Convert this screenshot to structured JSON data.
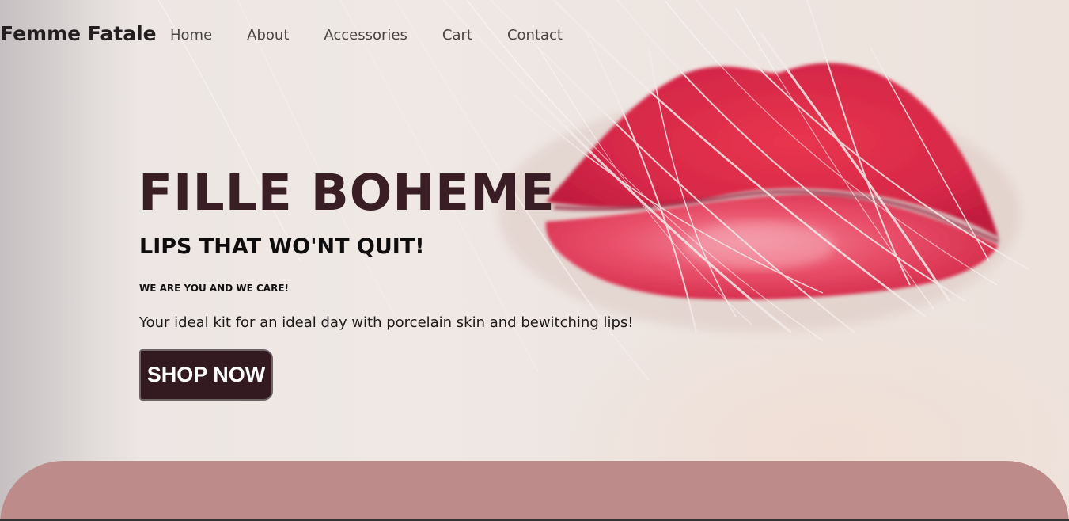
{
  "brand": "Femme Fatale",
  "nav": {
    "items": [
      "Home",
      "About",
      "Accessories",
      "Cart",
      "Contact"
    ]
  },
  "hero": {
    "headline": "FILLE BOHEME",
    "subheadline": "LIPS THAT WO'NT QUIT!",
    "tagline": "WE ARE YOU AND WE CARE!",
    "description": "Your ideal kit for an ideal day with porcelain skin and bewitching lips!",
    "cta_label": "SHOP NOW"
  },
  "colors": {
    "headline": "#3a1e25",
    "button_bg": "#331a20",
    "lips": "#d8244a",
    "section_pink": "#bd8c8a"
  }
}
